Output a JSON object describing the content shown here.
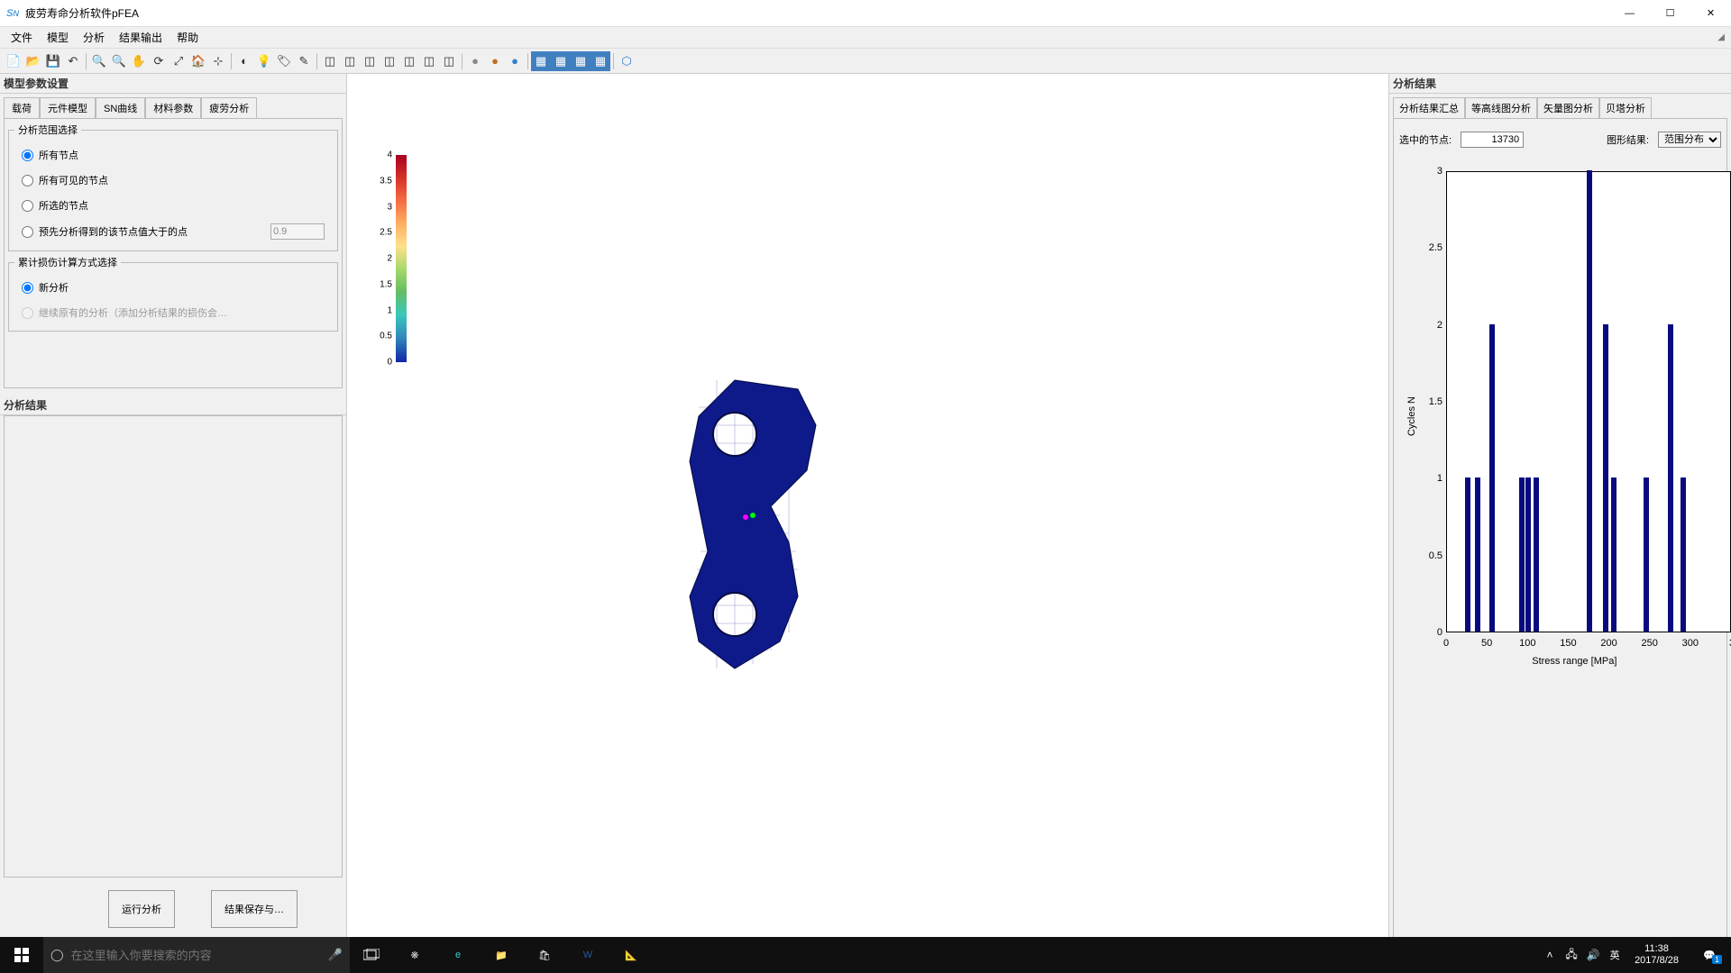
{
  "window": {
    "title": "疲劳寿命分析软件pFEA",
    "buttons": {
      "min": "—",
      "max": "☐",
      "close": "✕"
    }
  },
  "menu": {
    "items": [
      "文件",
      "模型",
      "分析",
      "结果输出",
      "帮助"
    ]
  },
  "toolbar": {
    "icons": [
      {
        "name": "new-file-icon",
        "glyph": "📄"
      },
      {
        "name": "open-icon",
        "glyph": "📂"
      },
      {
        "name": "save-icon",
        "glyph": "💾"
      },
      {
        "name": "undo-icon",
        "glyph": "↶"
      },
      {
        "name": "zoom-in-icon",
        "glyph": "🔍"
      },
      {
        "name": "zoom-out-icon",
        "glyph": "🔍"
      },
      {
        "name": "pan-icon",
        "glyph": "✋"
      },
      {
        "name": "rotate-icon",
        "glyph": "⟳"
      },
      {
        "name": "fit-icon",
        "glyph": "⤢"
      },
      {
        "name": "home-icon",
        "glyph": "🏠"
      },
      {
        "name": "axes-icon",
        "glyph": "⊹"
      },
      {
        "name": "toggle-1-icon",
        "glyph": "◐"
      },
      {
        "name": "light-icon",
        "glyph": "💡"
      },
      {
        "name": "label-icon",
        "glyph": "🏷"
      },
      {
        "name": "edit-icon",
        "glyph": "✎"
      },
      {
        "name": "cube1-icon",
        "glyph": "◫"
      },
      {
        "name": "cube2-icon",
        "glyph": "◫"
      },
      {
        "name": "cube3-icon",
        "glyph": "◫"
      },
      {
        "name": "cube4-icon",
        "glyph": "◫"
      },
      {
        "name": "cube5-icon",
        "glyph": "◫"
      },
      {
        "name": "cube6-icon",
        "glyph": "◫"
      },
      {
        "name": "cube7-icon",
        "glyph": "◫"
      },
      {
        "name": "sphere-gray-icon",
        "glyph": "●"
      },
      {
        "name": "sphere-orange-icon",
        "glyph": "●"
      },
      {
        "name": "sphere-blue-icon",
        "glyph": "●"
      },
      {
        "name": "view1-icon",
        "glyph": "▦"
      },
      {
        "name": "view2-icon",
        "glyph": "▦"
      },
      {
        "name": "view3-icon",
        "glyph": "▦"
      },
      {
        "name": "view4-icon",
        "glyph": "▦"
      },
      {
        "name": "hex-icon",
        "glyph": "⬡"
      }
    ]
  },
  "left_panel": {
    "title": "模型参数设置",
    "tabs": [
      "载荷",
      "元件模型",
      "SN曲线",
      "材料参数",
      "疲劳分析"
    ],
    "active_tab": 4,
    "group1": {
      "title": "分析范围选择",
      "radios": [
        {
          "label": "所有节点",
          "checked": true
        },
        {
          "label": "所有可见的节点",
          "checked": false
        },
        {
          "label": "所选的节点",
          "checked": false
        },
        {
          "label": "预先分析得到的该节点值大于的点",
          "checked": false,
          "value": "0.9"
        }
      ]
    },
    "group2": {
      "title": "累计损伤计算方式选择",
      "radios": [
        {
          "label": "新分析",
          "checked": true
        },
        {
          "label": "继续原有的分析（添加分析结果的损伤会…",
          "checked": false,
          "disabled": true
        }
      ]
    },
    "group3_title": "分析结果",
    "buttons": {
      "run": "运行分析",
      "save": "结果保存与…"
    }
  },
  "colorbar": {
    "ticks": [
      "4",
      "3.5",
      "3",
      "2.5",
      "2",
      "1.5",
      "1",
      "0.5",
      "0"
    ]
  },
  "right_panel": {
    "title": "分析结果",
    "tabs": [
      "分析结果汇总",
      "等高线图分析",
      "矢量图分析",
      "贝塔分析"
    ],
    "active_tab": 0,
    "node_label": "选中的节点:",
    "node_value": "13730",
    "graph_label": "图形结果:",
    "graph_options": [
      "范围分布"
    ],
    "graph_selected": "范围分布"
  },
  "chart_data": {
    "type": "bar",
    "xlabel": "Stress range [MPa]",
    "ylabel": "Cycles N",
    "xlim": [
      0,
      350
    ],
    "ylim": [
      0,
      3
    ],
    "xticks": [
      0,
      50,
      100,
      150,
      200,
      250,
      300
    ],
    "yticks": [
      0,
      0.5,
      1,
      1.5,
      2,
      2.5,
      3
    ],
    "bars": [
      {
        "x": 25,
        "y": 1
      },
      {
        "x": 38,
        "y": 1
      },
      {
        "x": 55,
        "y": 2
      },
      {
        "x": 92,
        "y": 1
      },
      {
        "x": 100,
        "y": 1
      },
      {
        "x": 110,
        "y": 1
      },
      {
        "x": 175,
        "y": 3
      },
      {
        "x": 195,
        "y": 2
      },
      {
        "x": 205,
        "y": 1
      },
      {
        "x": 245,
        "y": 1
      },
      {
        "x": 275,
        "y": 2
      },
      {
        "x": 290,
        "y": 1
      }
    ]
  },
  "taskbar": {
    "search_placeholder": "在这里输入你要搜索的内容",
    "ime": "英",
    "time": "11:38",
    "date": "2017/8/28",
    "notif_count": "1"
  }
}
